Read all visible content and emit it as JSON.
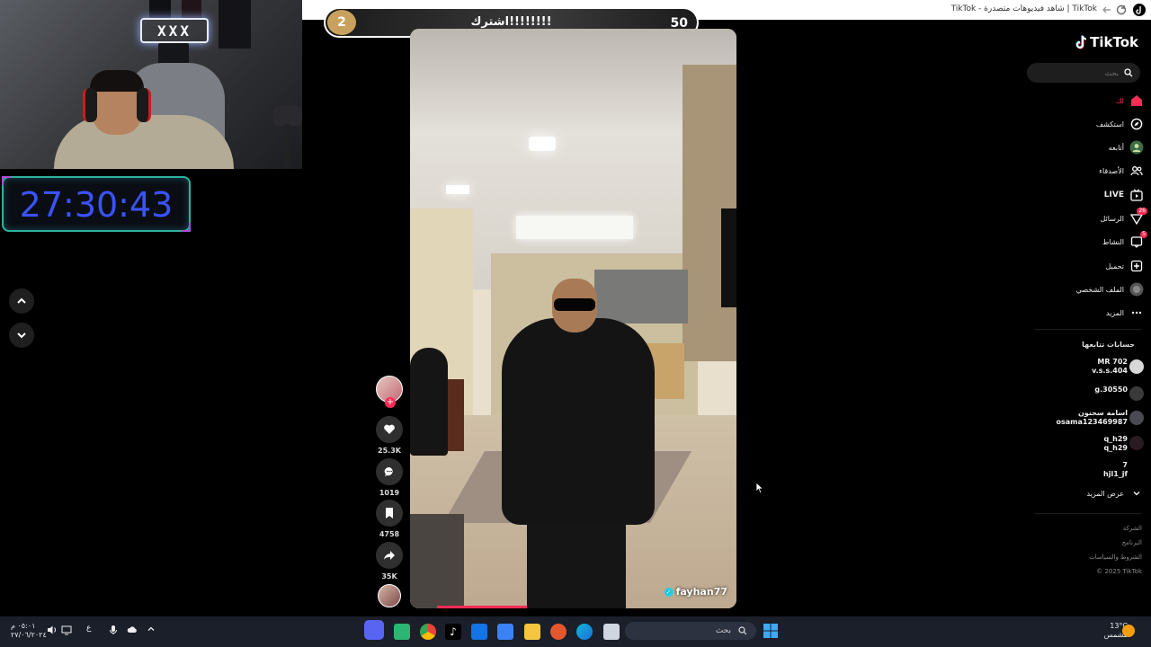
{
  "timer": {
    "value": "27:30:43"
  },
  "goal": {
    "current": "2",
    "label": "اشترك!!!!!!!!",
    "target": "50"
  },
  "browser": {
    "tab_title": "TikTok | شاهد فيديوهات متصدرة - TikTok"
  },
  "video": {
    "username": "fayhan77"
  },
  "actions": {
    "likes": "25.3K",
    "comments": "1019",
    "saves": "4758",
    "shares": "35K"
  },
  "sidebar": {
    "logo": "TikTok",
    "search_placeholder": "بحث",
    "nav": [
      {
        "label": "لك",
        "icon": "home-icon"
      },
      {
        "label": "استكشف",
        "icon": "compass-icon"
      },
      {
        "label": "أتابعه",
        "icon": "following-icon"
      },
      {
        "label": "الأصدقاء",
        "icon": "friends-icon"
      },
      {
        "label": "LIVE",
        "icon": "live-icon"
      },
      {
        "label": "الرسائل",
        "icon": "messages-icon",
        "badge": "26"
      },
      {
        "label": "النشاط",
        "icon": "activity-icon",
        "badge": "5"
      },
      {
        "label": "تحميل",
        "icon": "upload-icon"
      },
      {
        "label": "الملف الشخصي",
        "icon": "profile-icon"
      },
      {
        "label": "المزيد",
        "icon": "more-icon"
      }
    ],
    "following_title": "حسابات تتابعها",
    "following": [
      {
        "name": "MR 702",
        "handle": "v.s.s.404"
      },
      {
        "name": "",
        "handle": "g.30550"
      },
      {
        "name": "اسامه سحنون",
        "handle": "osama123469987"
      },
      {
        "name": "q_h29",
        "handle": "q_h29"
      },
      {
        "name": "7",
        "handle": "hjl1_jf"
      }
    ],
    "see_more": "عرض المزيد",
    "footer": [
      "الشركة",
      "البرنامج",
      "الشروط والسياسات",
      "© 2025 TikTok"
    ]
  },
  "taskbar": {
    "search_placeholder": "بحث",
    "clock_time": "٠٥:٠١ م",
    "clock_date": "٢٧/٠٦/٢٠٢٤",
    "weather_temp": "13°C",
    "weather_desc": "مشمس",
    "lang": "ع"
  },
  "colors": {
    "accent": "#fe2c55",
    "timer": "#3b52ff",
    "goal_badge": "#c9a15e"
  }
}
